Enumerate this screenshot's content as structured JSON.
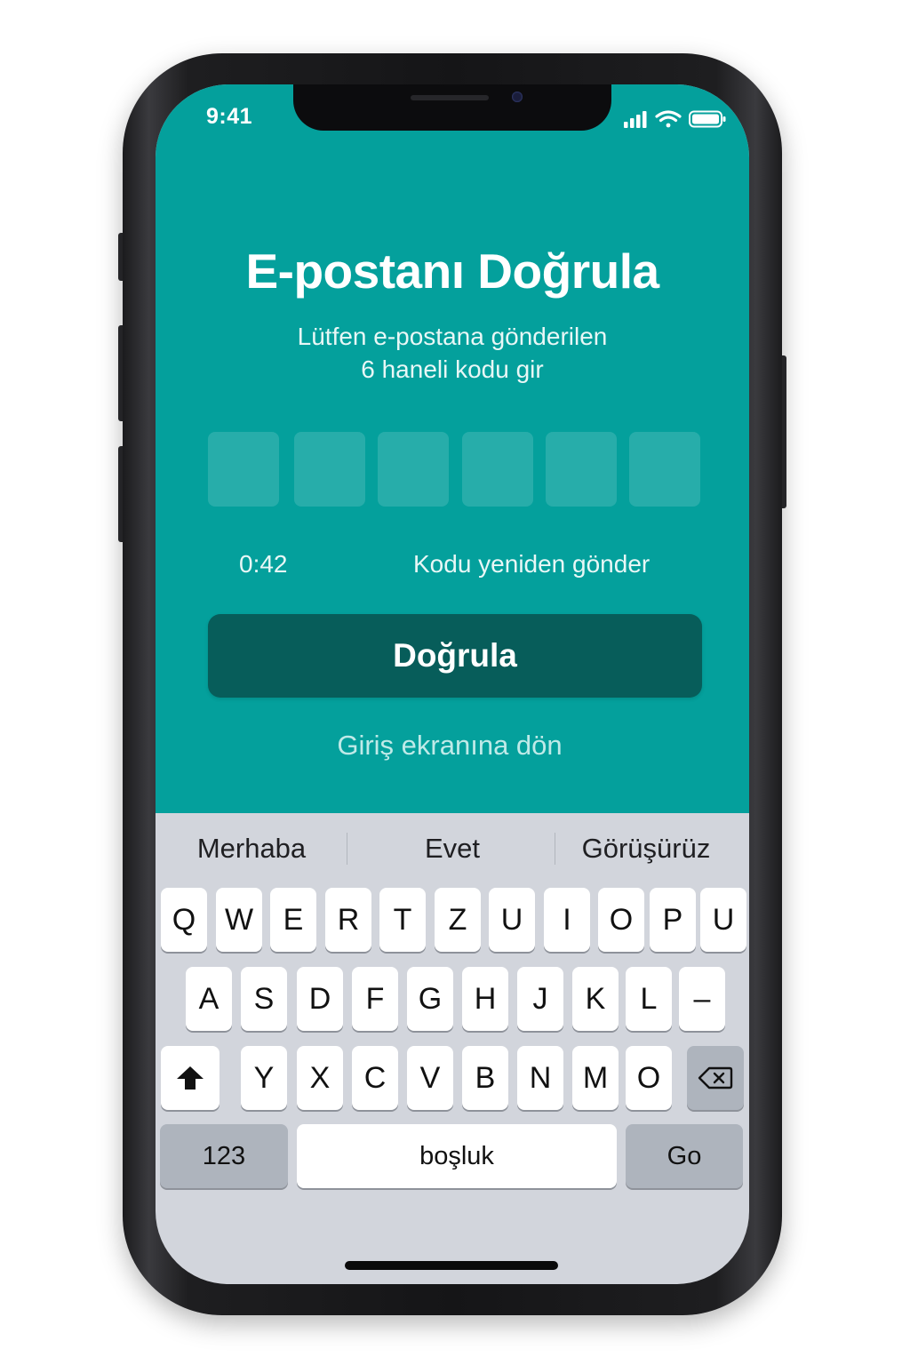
{
  "status_bar": {
    "time": "9:41",
    "signal_icon": "cellular-signal-icon",
    "wifi_icon": "wifi-icon",
    "battery_icon": "battery-icon"
  },
  "verify": {
    "title": "E-postanı Doğrula",
    "subtitle_line1": "Lütfen e-postana gönderilen",
    "subtitle_line2": "6 haneli kodu gir",
    "code_digits": [
      "",
      "",
      "",
      "",
      "",
      ""
    ],
    "timer": "0:42",
    "resend_label": "Kodu yeniden gönder",
    "verify_button": "Doğrula",
    "back_link": "Giriş ekranına dön"
  },
  "keyboard": {
    "suggestions": [
      "Merhaba",
      "Evet",
      "Görüşürüz"
    ],
    "row1": [
      "Q",
      "W",
      "E",
      "R",
      "T",
      "Z",
      "U",
      "I",
      "O",
      "P",
      "U"
    ],
    "row2": [
      "A",
      "S",
      "D",
      "F",
      "G",
      "H",
      "J",
      "K",
      "L",
      "–"
    ],
    "row3": [
      "Y",
      "X",
      "C",
      "V",
      "B",
      "N",
      "M",
      "O"
    ],
    "shift_icon": "shift-arrow-icon",
    "delete_icon": "backspace-icon",
    "numbers_key": "123",
    "space_key": "boşluk",
    "go_key": "Go"
  },
  "colors": {
    "primary": "#04a09c",
    "button": "#075d5a",
    "keyboard_bg": "#d2d5dc",
    "key_dark": "#aeb4bd"
  }
}
